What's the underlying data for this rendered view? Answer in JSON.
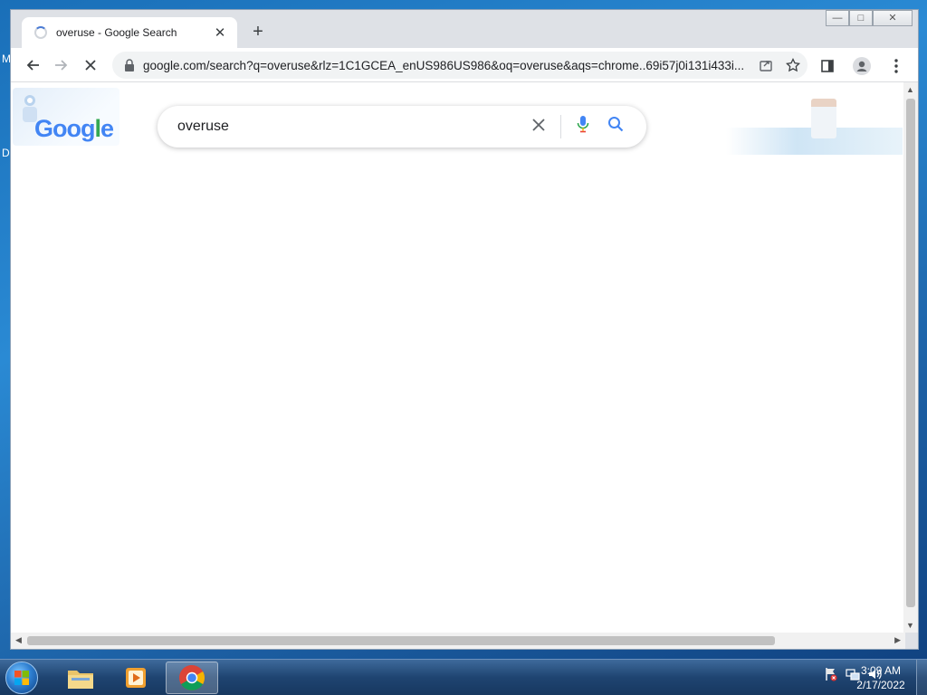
{
  "desktop": {
    "letters": [
      "M",
      "D"
    ]
  },
  "browser": {
    "tab": {
      "title": "overuse - Google Search",
      "close_glyph": "✕"
    },
    "new_tab_glyph": "+",
    "window_controls": {
      "minimize": "—",
      "maximize": "□",
      "close": "✕"
    },
    "address_bar": {
      "url": "google.com/search?q=overuse&rlz=1C1GCEA_enUS986US986&oq=overuse&aqs=chrome..69i57j0i131i433i..."
    }
  },
  "page": {
    "logo_text": "Google",
    "search": {
      "query": "overuse"
    }
  },
  "taskbar": {
    "clock": {
      "time": "3:09 AM",
      "date": "2/17/2022"
    }
  },
  "colors": {
    "google_blue": "#4285f4",
    "google_red": "#ea4335",
    "google_yellow": "#fbbc05",
    "google_green": "#34a853",
    "taskbar": "#1f4471"
  }
}
